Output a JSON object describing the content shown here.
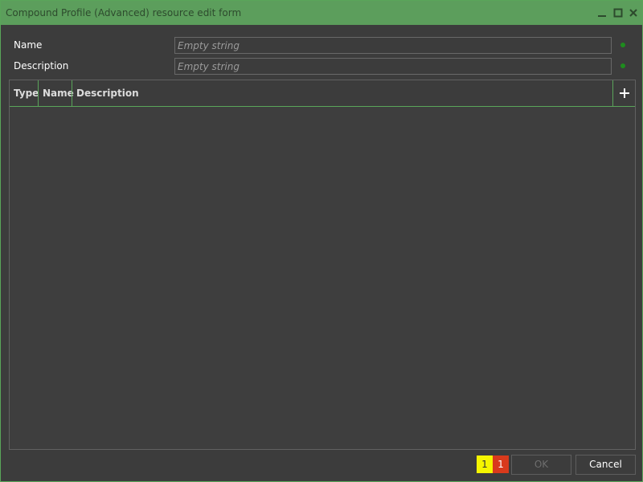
{
  "window": {
    "title": "Compound Profile (Advanced) resource edit form",
    "controls": {
      "minimize_icon": "minimize-icon",
      "maximize_icon": "maximize-icon",
      "close_icon": "close-icon"
    }
  },
  "form": {
    "name": {
      "label": "Name",
      "value": "",
      "placeholder": "Empty string"
    },
    "description": {
      "label": "Description",
      "value": "",
      "placeholder": "Empty string"
    }
  },
  "grid": {
    "columns": [
      "Type",
      "Name",
      "Description"
    ],
    "rows": [],
    "add_icon": "plus-icon"
  },
  "footer": {
    "warning_count": "1",
    "error_count": "1",
    "ok_label": "OK",
    "cancel_label": "Cancel"
  },
  "colors": {
    "titlebar": "#5c9e5c",
    "accent": "#5aa55a",
    "background": "#3c3c3c",
    "status_ok": "#1e8c1e",
    "warning": "#f5f500",
    "error": "#d93a1c"
  }
}
